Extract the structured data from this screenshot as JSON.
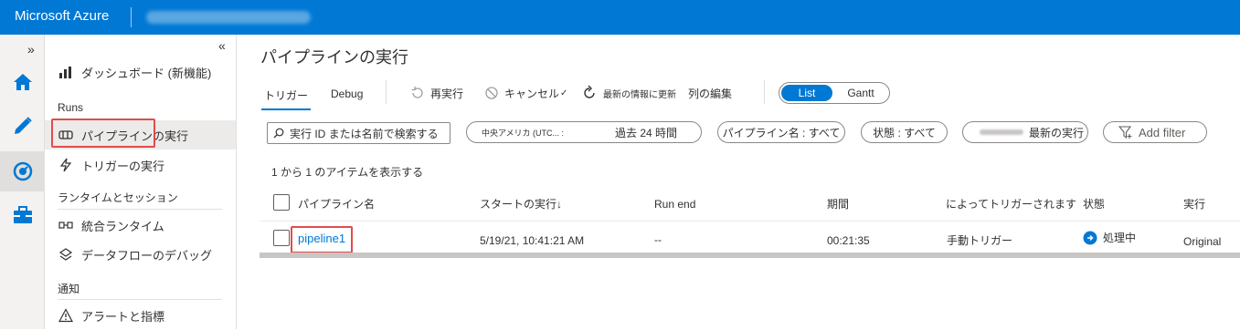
{
  "topbar": {
    "brand": "Microsoft Azure"
  },
  "rail": {
    "expand": "»",
    "items": [
      {
        "icon": "home-icon",
        "color": "#0078d4"
      },
      {
        "icon": "pencil-icon",
        "color": "#0078d4"
      },
      {
        "icon": "monitor-gauge-icon",
        "color": "#0078d4"
      },
      {
        "icon": "toolbox-icon",
        "color": "#0078d4"
      }
    ]
  },
  "nav": {
    "collapse": "«",
    "dashboard": "ダッシュボード (新機能)",
    "section_runs": "Runs",
    "pipeline_runs": "パイプラインの実行",
    "trigger_runs": "トリガーの実行",
    "section_runtimes": "ランタイムとセッション",
    "integration_runtimes": "統合ランタイム",
    "dataflow_debug": "データフローのデバッグ",
    "section_notifications": "通知",
    "alerts": "アラートと指標"
  },
  "main": {
    "title": "パイプラインの実行",
    "tabs": [
      "トリガー",
      "Debug"
    ],
    "toolbar": {
      "rerun": "再実行",
      "cancel": "キャンセル",
      "refresh": "最新の情報に更新",
      "edit_columns": "列の編集"
    },
    "view_toggle": {
      "list": "List",
      "gantt": "Gantt"
    },
    "filters": {
      "search_placeholder": "実行 ID または名前で検索する",
      "timezone": "中央アメリカ (UTC... :",
      "time_range": "過去 24 時間",
      "pipeline_name": "パイプライン名 : すべて",
      "status": "状態 : すべて",
      "latest_runs": "最新の実行",
      "add_filter": "Add filter"
    },
    "count_text": "1 から 1 のアイテムを表示する",
    "table": {
      "columns": [
        "パイプライン名",
        "スタートの実行↓",
        "Run end",
        "期間",
        "によってトリガーされます",
        "状態",
        "実行"
      ],
      "rows": [
        {
          "pipeline_name": "pipeline1",
          "run_start": "5/19/21, 10:41:21 AM",
          "run_end": "--",
          "duration": "00:21:35",
          "triggered_by": "手動トリガー",
          "status": "処理中",
          "run": "Original"
        }
      ]
    }
  },
  "colors": {
    "accent": "#0078d4",
    "highlight_box": "#e04c4c"
  }
}
